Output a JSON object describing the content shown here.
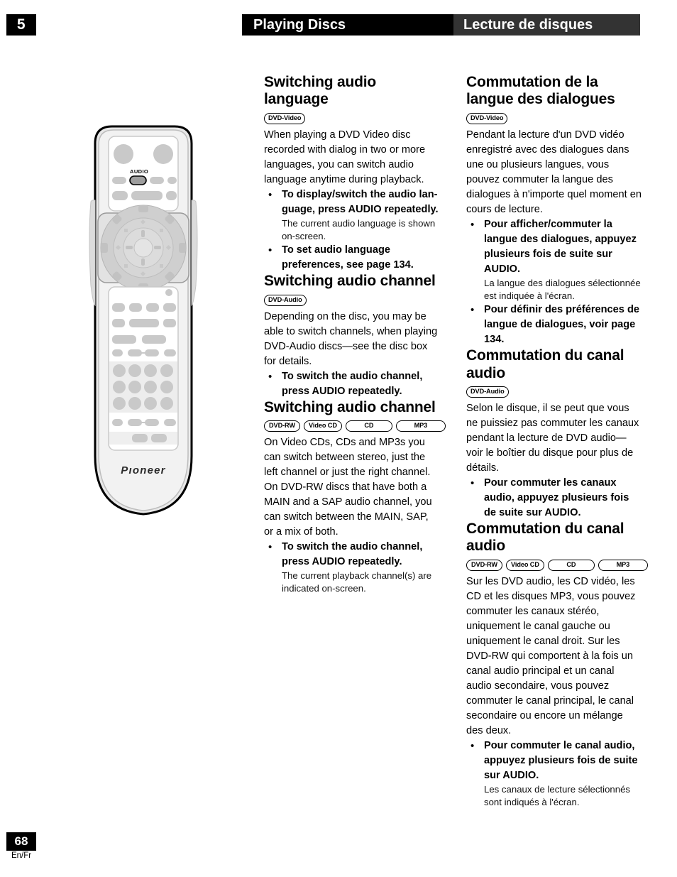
{
  "header": {
    "chapter_number": "5",
    "title_en": "Playing Discs",
    "title_fr": "Lecture de disques",
    "bg_en": "#000000",
    "bg_fr": "#333333"
  },
  "footer": {
    "page_number": "68",
    "languages": "En/Fr"
  },
  "illustration": {
    "device": "remote-control",
    "brand": "Pioneer",
    "highlighted_button_label": "AUDIO"
  },
  "english": {
    "section1": {
      "heading": "Switching audio language",
      "badges": [
        "DVD-Video"
      ],
      "intro": "When playing a DVD Video disc recorded with dialog in two or more languages, you can switch audio language anytime during playback.",
      "bullets": [
        {
          "strong": "To display/switch the audio lan-guage, press AUDIO repeatedly.",
          "note": "The current audio language is shown on-screen."
        },
        {
          "strong": "To set audio language preferences, see page 134.",
          "note": ""
        }
      ]
    },
    "section2": {
      "heading": "Switching audio channel",
      "badges": [
        "DVD-Audio"
      ],
      "intro": "Depending on the disc, you may be able to switch channels, when playing DVD-Audio discs—see the disc box for details.",
      "bullets": [
        {
          "strong": "To switch the audio channel, press AUDIO repeatedly.",
          "note": ""
        }
      ]
    },
    "section3": {
      "heading": "Switching audio channel",
      "badges": [
        "DVD-RW",
        "Video CD",
        "CD",
        "MP3"
      ],
      "intro": "On Video CDs, CDs and MP3s you can switch between stereo, just the left channel or just the right channel. On DVD-RW discs that have both a MAIN and a SAP audio channel, you can switch between the MAIN, SAP, or a mix of both.",
      "bullets": [
        {
          "strong": "To switch the audio channel, press AUDIO repeatedly.",
          "note": "The current playback channel(s) are indicated on-screen."
        }
      ]
    }
  },
  "french": {
    "section1": {
      "heading": "Commutation de la langue des dialogues",
      "badges": [
        "DVD-Video"
      ],
      "intro": "Pendant la lecture d'un DVD vidéo enregistré avec des dialogues dans une ou plusieurs langues, vous pouvez commuter la langue des dialogues à n'importe quel moment en cours de lecture.",
      "bullets": [
        {
          "strong": "Pour afficher/commuter la langue des dialogues, appuyez plusieurs fois de suite sur AUDIO.",
          "note": "La langue des dialogues sélectionnée est indiquée à l'écran."
        },
        {
          "strong": "Pour définir des préférences de langue de dialogues, voir page 134.",
          "note": ""
        }
      ]
    },
    "section2": {
      "heading": "Commutation du canal audio",
      "badges": [
        "DVD-Audio"
      ],
      "intro": "Selon le disque, il se peut que vous ne puissiez pas commuter les canaux pendant la lecture de DVD audio—voir le boîtier du disque pour plus de détails.",
      "bullets": [
        {
          "strong": "Pour commuter les canaux audio, appuyez plusieurs fois de suite sur AUDIO.",
          "note": ""
        }
      ]
    },
    "section3": {
      "heading": "Commutation du canal audio",
      "badges": [
        "DVD-RW",
        "Video CD",
        "CD",
        "MP3"
      ],
      "intro": "Sur les DVD audio, les CD vidéo, les CD et les disques MP3, vous pouvez commuter les canaux stéréo, uniquement le canal gauche ou uniquement le canal droit. Sur les DVD-RW qui comportent à la fois un canal audio principal et un canal audio secondaire, vous pouvez commuter le canal principal, le canal secondaire ou encore un mélange des deux.",
      "bullets": [
        {
          "strong": "Pour commuter le canal audio, appuyez plusieurs fois de suite sur AUDIO.",
          "note": "Les canaux de lecture sélectionnés sont indiqués à l'écran."
        }
      ]
    }
  }
}
